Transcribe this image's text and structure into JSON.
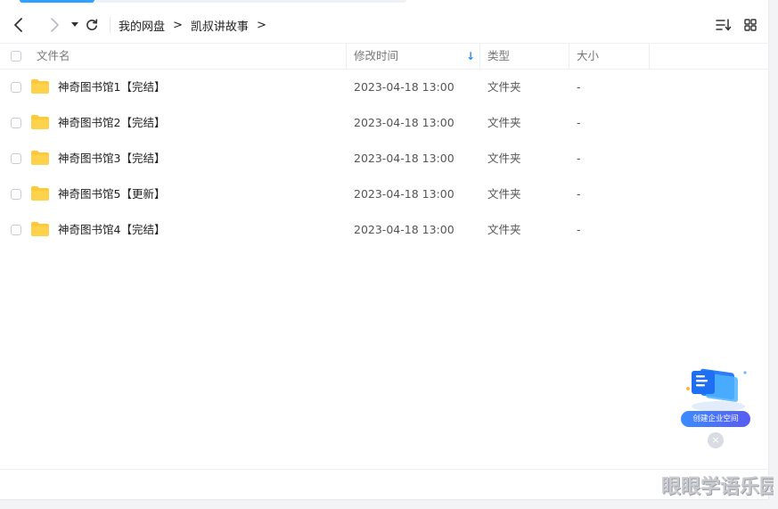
{
  "navigation": {
    "breadcrumbs": [
      "我的网盘",
      "凯叔讲故事"
    ],
    "separator": ">"
  },
  "table": {
    "columns": {
      "name": "文件名",
      "modified": "修改时间",
      "type": "类型",
      "size": "大小"
    },
    "sort_indicator": "↓",
    "rows": [
      {
        "name": "神奇图书馆1【完结】",
        "modified": "2023-04-18 13:00",
        "type": "文件夹",
        "size": "-"
      },
      {
        "name": "神奇图书馆2【完结】",
        "modified": "2023-04-18 13:00",
        "type": "文件夹",
        "size": "-"
      },
      {
        "name": "神奇图书馆3【完结】",
        "modified": "2023-04-18 13:00",
        "type": "文件夹",
        "size": "-"
      },
      {
        "name": "神奇图书馆5【更新】",
        "modified": "2023-04-18 13:00",
        "type": "文件夹",
        "size": "-"
      },
      {
        "name": "神奇图书馆4【完结】",
        "modified": "2023-04-18 13:00",
        "type": "文件夹",
        "size": "-"
      }
    ]
  },
  "promo": {
    "label": "创建企业空间",
    "close": "×"
  },
  "watermark": {
    "text": "眼眼学语乐园"
  },
  "colors": {
    "accent": "#2ea1ff",
    "folder": "#ffc93a",
    "sort_arrow": "#2a8cf0"
  }
}
